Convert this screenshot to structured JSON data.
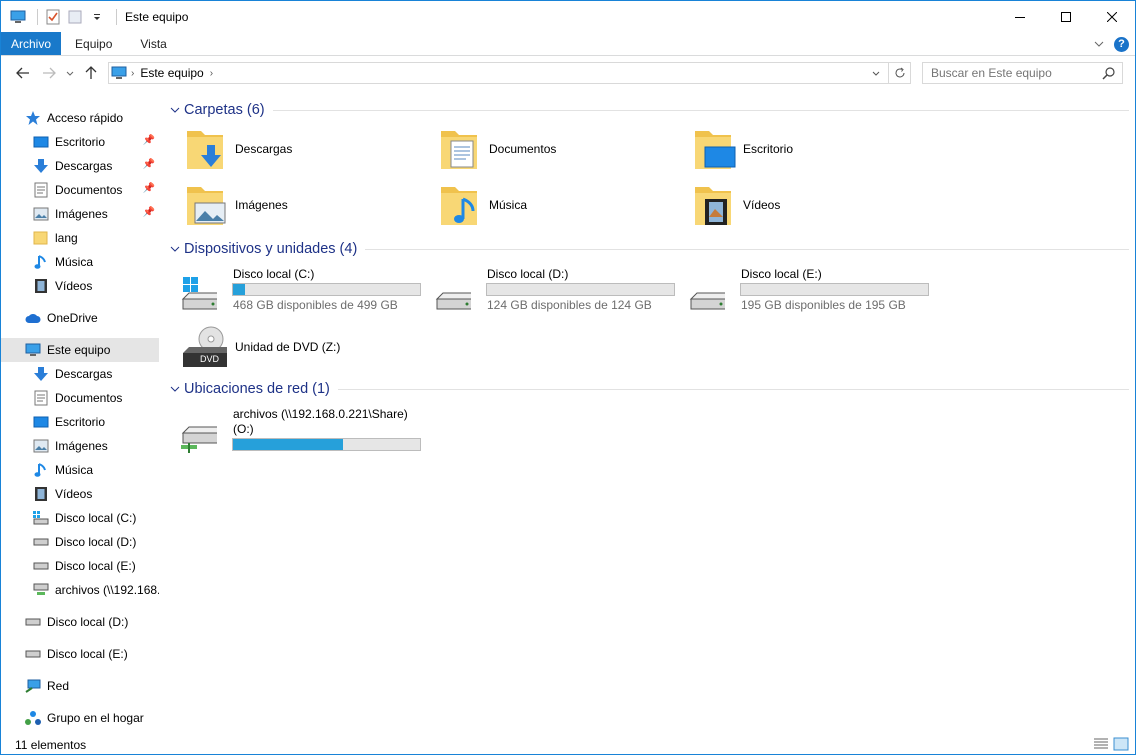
{
  "window": {
    "title": "Este equipo"
  },
  "ribbon": {
    "tabs": [
      "Archivo",
      "Equipo",
      "Vista"
    ]
  },
  "nav": {
    "breadcrumb": "Este equipo",
    "search_placeholder": "Buscar en Este equipo"
  },
  "sidebar": {
    "quick_access": "Acceso rápido",
    "quick_items": [
      "Escritorio",
      "Descargas",
      "Documentos",
      "Imágenes",
      "lang",
      "Música",
      "Vídeos"
    ],
    "onedrive": "OneDrive",
    "this_pc": "Este equipo",
    "pc_items": [
      "Descargas",
      "Documentos",
      "Escritorio",
      "Imágenes",
      "Música",
      "Vídeos",
      "Disco local (C:)",
      "Disco local (D:)",
      "Disco local (E:)",
      "archivos (\\\\192.168."
    ],
    "extra_drives": [
      "Disco local (D:)",
      "Disco local (E:)"
    ],
    "network": "Red",
    "homegroup": "Grupo en el hogar"
  },
  "content": {
    "folders_title": "Carpetas (6)",
    "folders": [
      "Descargas",
      "Documentos",
      "Escritorio",
      "Imágenes",
      "Música",
      "Vídeos"
    ],
    "devices_title": "Dispositivos y unidades (4)",
    "drives": [
      {
        "name": "Disco local (C:)",
        "free": "468 GB disponibles de 499 GB",
        "used_fraction": 0.062
      },
      {
        "name": "Disco local (D:)",
        "free": "124 GB disponibles de 124 GB",
        "used_fraction": 0.0
      },
      {
        "name": "Disco local (E:)",
        "free": "195 GB disponibles de 195 GB",
        "used_fraction": 0.0
      }
    ],
    "dvd": {
      "name": "Unidad de DVD (Z:)",
      "badge": "DVD"
    },
    "network_title": "Ubicaciones de red (1)",
    "network_drive": {
      "name_line1": "archivos (\\\\192.168.0.221\\Share)",
      "name_line2": "(O:)",
      "used_fraction": 0.59
    }
  },
  "status": {
    "count": "11 elementos"
  },
  "colors": {
    "accent": "#1979ca",
    "group_title": "#1e3287",
    "bar_fill": "#26a0da"
  }
}
